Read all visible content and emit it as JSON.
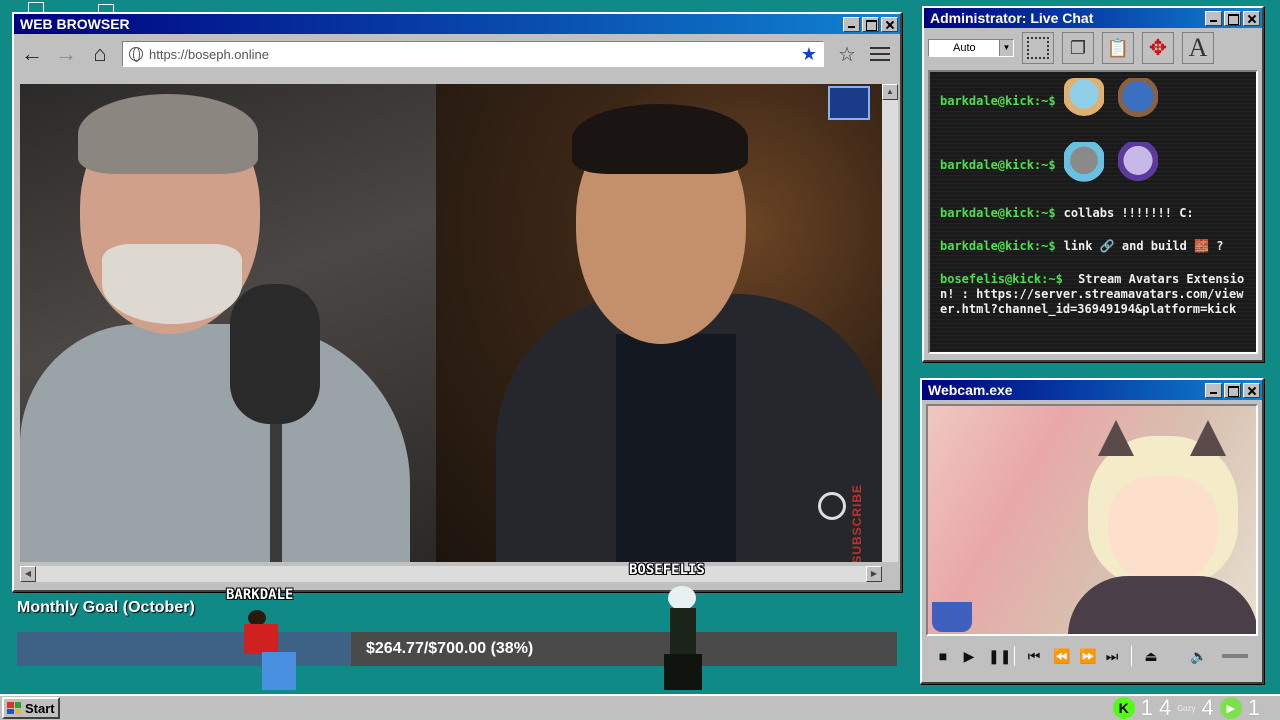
{
  "browser": {
    "title": "WEB BROWSER",
    "url": "https://boseph.online",
    "nav": {
      "back": "←",
      "forward": "→"
    },
    "video": {
      "subscribe_label": "SUBSCRIBE"
    }
  },
  "chat": {
    "title": "Administrator: Live Chat",
    "dropdown_value": "Auto",
    "messages": [
      {
        "user": "barkdale@kick:~$",
        "text": ""
      },
      {
        "user": "barkdale@kick:~$",
        "text": ""
      },
      {
        "user": "barkdale@kick:~$",
        "text": "collabs !!!!!!! C:"
      },
      {
        "user": "barkdale@kick:~$",
        "text": "link 🔗 and build 🧱 ?"
      },
      {
        "user": "bosefelis@kick:~$",
        "text": "Stream Avatars Extension! : https://server.streamavatars.com/viewer.html?channel_id=36949194&platform=kick"
      }
    ]
  },
  "webcam": {
    "title": "Webcam.exe"
  },
  "goal": {
    "title": "Monthly Goal (October)",
    "text": "$264.77/$700.00 (38%)",
    "progress_fraction": 0.38
  },
  "avatars": {
    "first": "BARKDALE",
    "second": "BOSEFELIS"
  },
  "taskbar": {
    "start_label": "Start",
    "kick_icon_letter": "K",
    "count_a": "1 4",
    "cozy_label": "Cozy",
    "count_b": "4",
    "count_c": "1"
  },
  "colors": {
    "desktop": "#0f8a86",
    "titlebar": "#000080",
    "chat_user": "#4ce04c",
    "goal_fill": "#3d6286",
    "kick_green": "#53fc18"
  }
}
